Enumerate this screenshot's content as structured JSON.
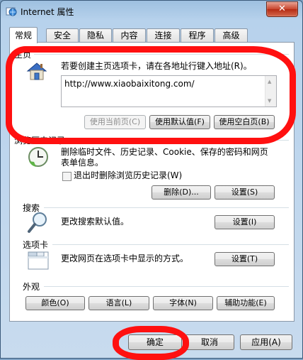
{
  "window": {
    "title": "Internet 属性",
    "close_label": "✕"
  },
  "tabs": [
    {
      "label": "常规",
      "active": true
    },
    {
      "label": "安全"
    },
    {
      "label": "隐私"
    },
    {
      "label": "内容"
    },
    {
      "label": "连接"
    },
    {
      "label": "程序"
    },
    {
      "label": "高级"
    }
  ],
  "homepage": {
    "group_label": "主页",
    "description": "若要创建主页选项卡，请在各地址行键入地址(R)。",
    "url": "http://www.xiaobaixitong.com/",
    "use_current": "使用当前页(C)",
    "use_default": "使用默认值(F)",
    "use_blank": "使用空白页(B)"
  },
  "history": {
    "group_label": "浏览历史记录",
    "description": "删除临时文件、历史记录、Cookie、保存的密码和网页表单信息。",
    "checkbox_label": "退出时删除浏览历史记录(W)",
    "checkbox_checked": false,
    "delete_button": "删除(D)...",
    "settings_button": "设置(S)"
  },
  "search": {
    "group_label": "搜索",
    "description": "更改搜索默认值。",
    "settings_button": "设置(I)"
  },
  "tabs_section": {
    "group_label": "选项卡",
    "description": "更改网页在选项卡中显示的方式。",
    "settings_button": "设置(T)"
  },
  "appearance": {
    "group_label": "外观",
    "colors": "颜色(O)",
    "languages": "语言(L)",
    "fonts": "字体(N)",
    "accessibility": "辅助功能(E)"
  },
  "dialog_buttons": {
    "ok": "确定",
    "cancel": "取消",
    "apply": "应用(A)"
  },
  "colors": {
    "annotation": "#ff1010",
    "titlebar": "#b7d2ec"
  }
}
